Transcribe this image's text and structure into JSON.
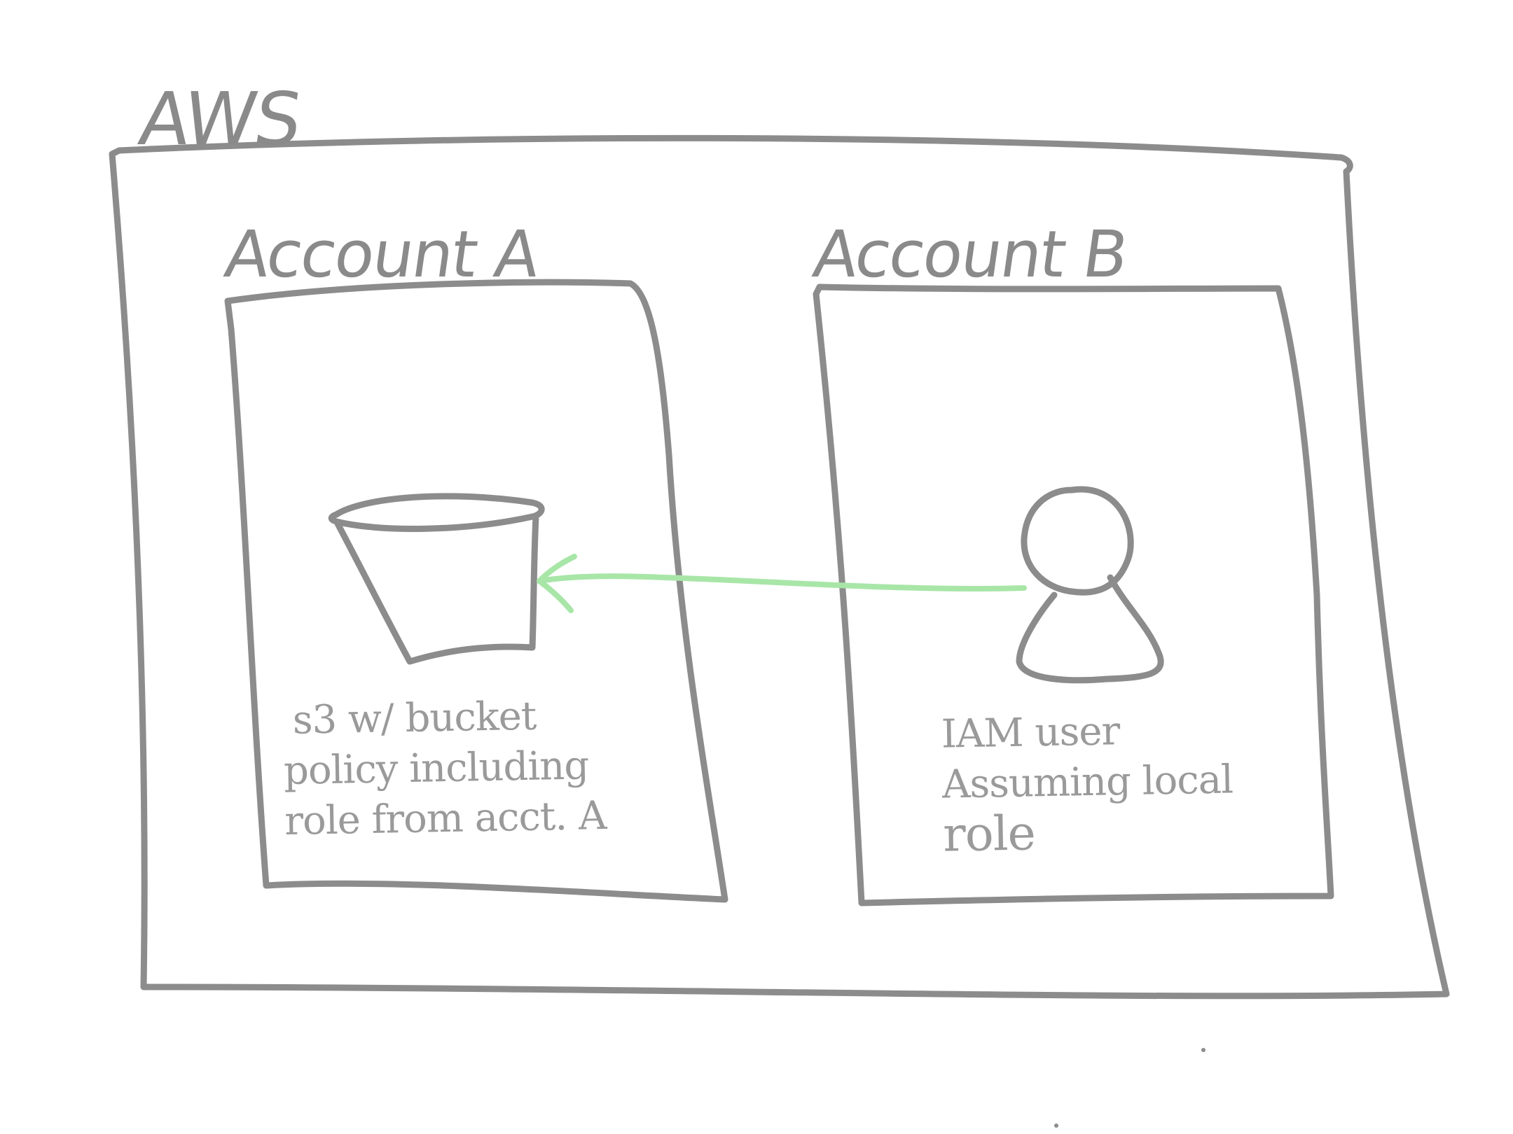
{
  "colors": {
    "stroke": "#8c8c8c",
    "text": "#8a8a8a",
    "label_text": "#9a9a9a",
    "arrow": "#a8e6a8",
    "background": "#ffffff"
  },
  "diagram": {
    "outer_label": "AWS",
    "account_a": {
      "label": "Account A",
      "icon": "bucket-icon",
      "caption_lines": [
        "s3 w/ bucket",
        "policy including",
        "role from acct. A"
      ]
    },
    "account_b": {
      "label": "Account B",
      "icon": "user-icon",
      "caption_lines": [
        "IAM user",
        "Assuming local",
        "role"
      ]
    },
    "arrow": {
      "from": "IAM user",
      "to": "s3 bucket"
    }
  }
}
